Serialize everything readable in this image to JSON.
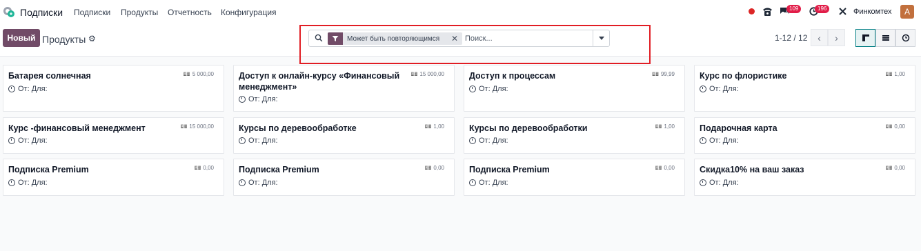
{
  "navbar": {
    "app_name": "Подписки",
    "menu": [
      "Подписки",
      "Продукты",
      "Отчетность",
      "Конфигурация"
    ],
    "messages_count": "109",
    "activities_count": "196",
    "company": "Финкомтех",
    "avatar_letter": "A"
  },
  "control_panel": {
    "new_button": "Новый",
    "title": "Продукты",
    "facet_label": "Может быть повторяющимся",
    "search_placeholder": "Поиск...",
    "pager": "1-12 / 12"
  },
  "colors": {
    "brand": "#714b67",
    "highlight": "#e11d24",
    "badge": "#e11d48"
  },
  "cards": [
    {
      "title": "Батарея солнечная",
      "price": "5 000,00",
      "meta": "От: Для:"
    },
    {
      "title": "Доступ к онлайн-курсу «Финансовый менеджмент»",
      "price": "15 000,00",
      "meta": "От: Для:"
    },
    {
      "title": "Доступ к процессам",
      "price": "99,99",
      "meta": "От: Для:"
    },
    {
      "title": "Курс по флористике",
      "price": "1,00",
      "meta": "От: Для:"
    },
    {
      "title": "Курс -финансовый менеджмент",
      "price": "15 000,00",
      "meta": "От: Для:"
    },
    {
      "title": "Курсы по деревообработке",
      "price": "1,00",
      "meta": "От: Для:"
    },
    {
      "title": "Курсы по деревообработки",
      "price": "1,00",
      "meta": "От: Для:"
    },
    {
      "title": "Подарочная карта",
      "price": "0,00",
      "meta": "От: Для:"
    },
    {
      "title": "Подписка Premium",
      "price": "0,00",
      "meta": "От: Для:"
    },
    {
      "title": "Подписка Premium",
      "price": "0,00",
      "meta": "От: Для:"
    },
    {
      "title": "Подписка Premium",
      "price": "0,00",
      "meta": "От: Для:"
    },
    {
      "title": "Скидка10% на ваш заказ",
      "price": "0,00",
      "meta": "От: Для:"
    }
  ]
}
